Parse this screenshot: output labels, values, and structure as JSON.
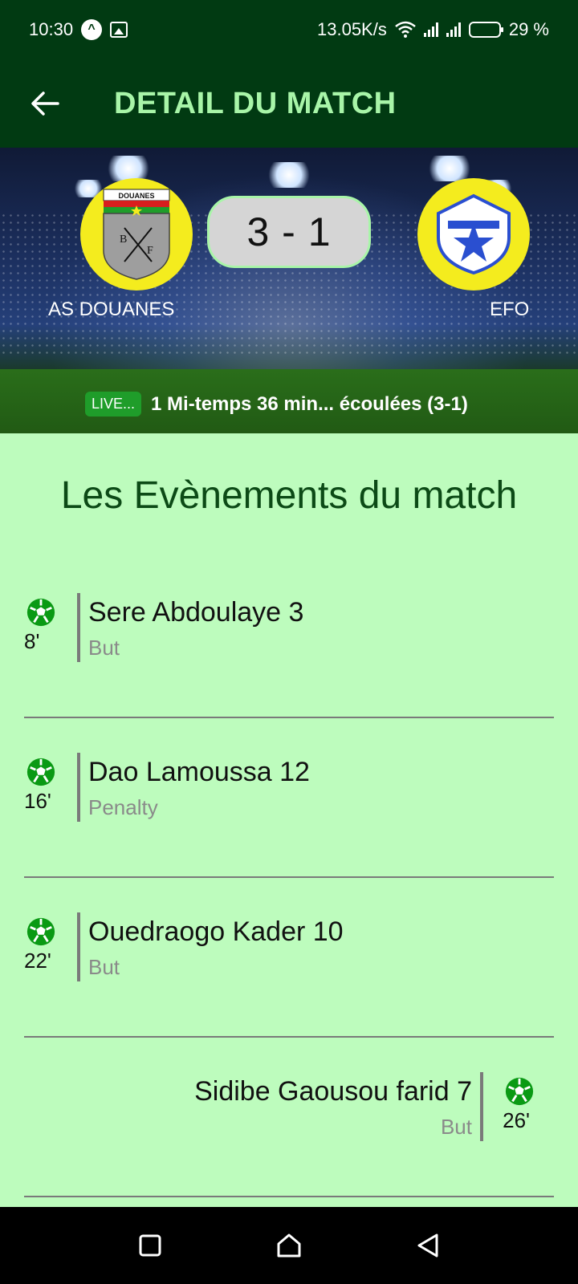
{
  "status_bar": {
    "time": "10:30",
    "network_speed": "13.05K/s",
    "battery": "29 %"
  },
  "app_bar": {
    "title": "DETAIL DU MATCH",
    "back_icon": "arrow-left-icon"
  },
  "match": {
    "home_team": "AS DOUANES",
    "away_team": "EFO",
    "home_logo_text": "DOUANES",
    "score": "3 - 1",
    "live_badge": "LIVE...",
    "status_text": "1 Mi-temps  36 min... écoulées (3-1)"
  },
  "events_title": "Les Evènements du match",
  "events": [
    {
      "side": "home",
      "minute": "8'",
      "player": "Sere Abdoulaye 3",
      "type": "But"
    },
    {
      "side": "home",
      "minute": "16'",
      "player": "Dao Lamoussa 12",
      "type": "Penalty"
    },
    {
      "side": "home",
      "minute": "22'",
      "player": "Ouedraogo Kader 10",
      "type": "But"
    },
    {
      "side": "away",
      "minute": "26'",
      "player": "Sidibe Gaousou farid 7",
      "type": "But"
    }
  ],
  "colors": {
    "app_bar": "#013a12",
    "title": "#a8f5a8",
    "page_bg": "#bdfcbd",
    "ball": "#0a9a14",
    "logo_bg": "#f4ec1e"
  },
  "nav": {
    "recents_icon": "square-icon",
    "home_icon": "home-icon",
    "back_icon": "triangle-back-icon"
  }
}
